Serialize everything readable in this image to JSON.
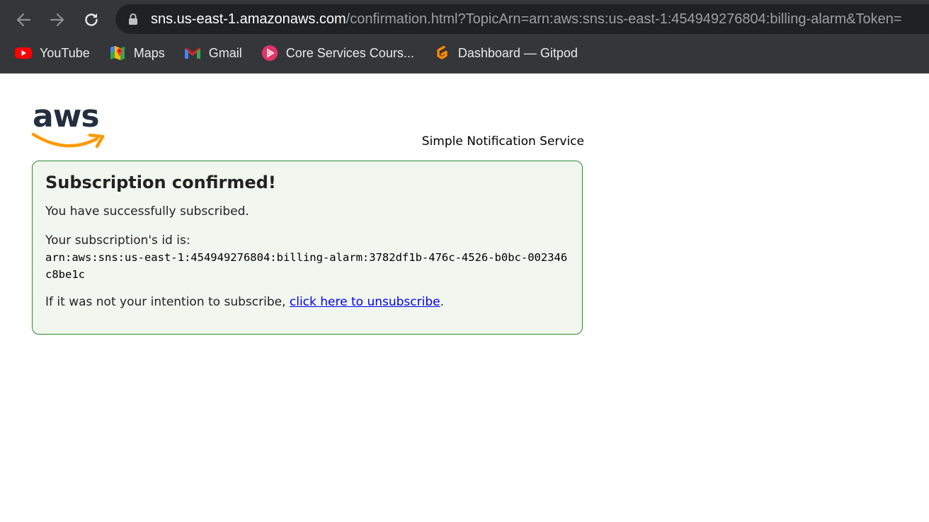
{
  "browser": {
    "url_host": "sns.us-east-1.amazonaws.com",
    "url_rest": "/confirmation.html?TopicArn=arn:aws:sns:us-east-1:454949276804:billing-alarm&Token=",
    "bookmarks": [
      {
        "label": "YouTube",
        "icon": "youtube-icon"
      },
      {
        "label": "Maps",
        "icon": "maps-icon"
      },
      {
        "label": "Gmail",
        "icon": "gmail-icon"
      },
      {
        "label": "Core Services Cours...",
        "icon": "play-circle-icon"
      },
      {
        "label": "Dashboard — Gitpod",
        "icon": "gitpod-icon"
      }
    ]
  },
  "page": {
    "logo_text": "aws",
    "service_name": "Simple Notification Service",
    "heading": "Subscription confirmed!",
    "success_text": "You have successfully subscribed.",
    "id_label": "Your subscription's id is:",
    "subscription_arn": "arn:aws:sns:us-east-1:454949276804:billing-alarm:3782df1b-476c-4526-b0bc-002346c8be1c",
    "unsubscribe_prefix": "If it was not your intention to subscribe, ",
    "unsubscribe_link": "click here to unsubscribe",
    "unsubscribe_suffix": "."
  },
  "colors": {
    "panel_border": "#2e8b2e",
    "panel_background": "#f1f6ef",
    "aws_orange": "#ff9900",
    "aws_navy": "#232f3e",
    "link": "#0000ee"
  }
}
